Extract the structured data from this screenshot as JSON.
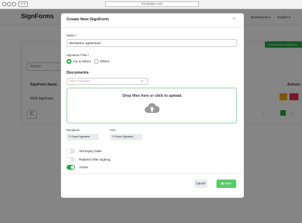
{
  "browser": {
    "url": "localsign.com",
    "back_label": "< >"
  },
  "app": {
    "brand": "SignForms",
    "workspaces": "Workspaces ▾",
    "language": "English ▾",
    "create_button": "+ Create New SignForm",
    "search_placeholder": "Search",
    "table": {
      "col_name": "SignForm Name",
      "col_actions": "Actions",
      "row_name": "NDA SignForm"
    },
    "refresh": "C",
    "pagination": {
      "prev": "«",
      "next": "»",
      "page": "1"
    }
  },
  "modal": {
    "title": "Create New SignForm",
    "close": "×",
    "name_label": "Name *",
    "name_value": "Disclaimer agreement",
    "flow_label": "Signature Flow *",
    "flow_options": [
      "You & Others",
      "Others"
    ],
    "documents_title": "Documents",
    "template_placeholder": "Select Template",
    "dropzone_text": "Drop files here or click to upload.",
    "recipient_label": "Recipient",
    "you_label": "You",
    "draw_signature": "Draw Signature",
    "toggles": [
      {
        "label": "Set Expiry Date",
        "on": false
      },
      {
        "label": "Redirect After Signing",
        "on": false
      },
      {
        "label": "Active",
        "on": true
      }
    ],
    "cancel": "Cancel",
    "save": "Save"
  },
  "colors": {
    "accent": "#28a745",
    "save": "#5bc86a",
    "danger": "#dc3545",
    "warning": "#f0a500"
  }
}
